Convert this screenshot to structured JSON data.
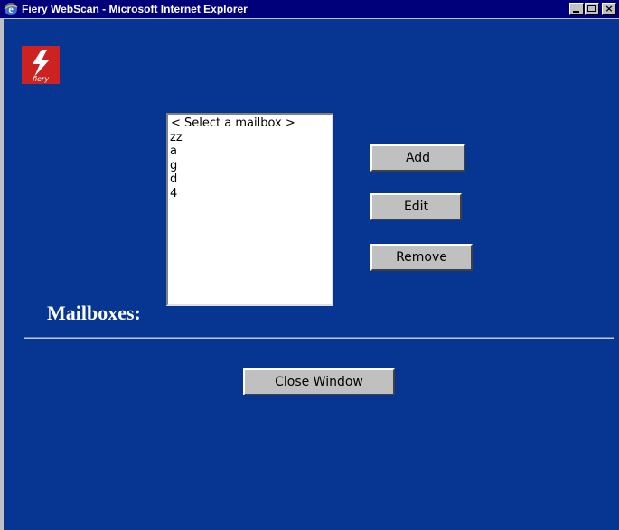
{
  "window": {
    "title": "Fiery WebScan - Microsoft Internet Explorer",
    "icon": "ie-icon",
    "controls": [
      "minimize-icon",
      "maximize-icon",
      "close-icon"
    ]
  },
  "logo": {
    "name": "fiery-logo",
    "text": "fiery",
    "color": "#cc2222"
  },
  "mailboxes": {
    "label": "Mailboxes:",
    "items": [
      "< Select a mailbox >",
      "zz",
      "a",
      "g",
      "d",
      "4"
    ]
  },
  "buttons": {
    "add": "Add",
    "edit": "Edit",
    "remove": "Remove",
    "close_window": "Close Window"
  },
  "colors": {
    "background": "#063692",
    "titlebar": "#00007b",
    "button": "#c0c0c0"
  }
}
